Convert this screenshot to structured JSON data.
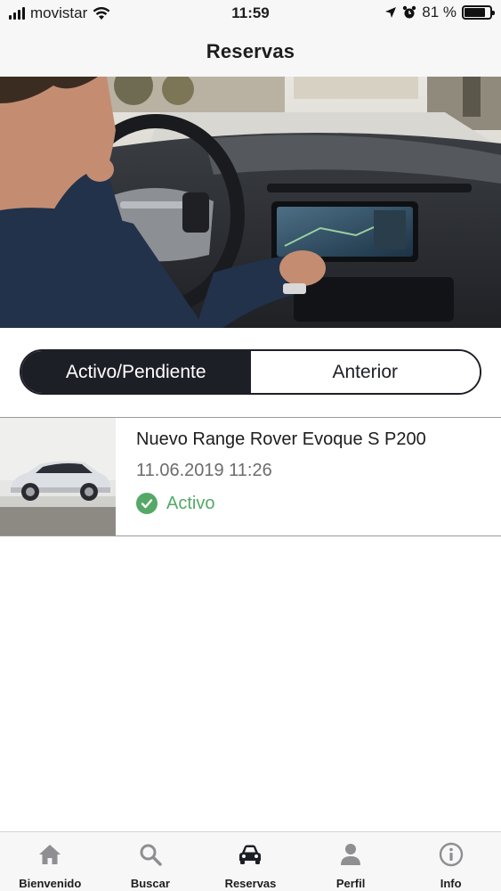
{
  "status_bar": {
    "carrier": "movistar",
    "time": "11:59",
    "battery": "81 %",
    "battery_level": 0.81
  },
  "header": {
    "title": "Reservas"
  },
  "segments": {
    "active_label": "Activo/Pendiente",
    "past_label": "Anterior",
    "selected": "active"
  },
  "reservations": [
    {
      "title": "Nuevo Range Rover Evoque S P200",
      "date": "11.06.2019 11:26",
      "status": "Activo",
      "status_color": "#55a868"
    }
  ],
  "tabs": [
    {
      "label": "Bienvenido",
      "icon": "home-icon"
    },
    {
      "label": "Buscar",
      "icon": "search-icon"
    },
    {
      "label": "Reservas",
      "icon": "car-icon",
      "selected": true
    },
    {
      "label": "Perfil",
      "icon": "person-icon"
    },
    {
      "label": "Info",
      "icon": "info-icon"
    }
  ],
  "colors": {
    "accent_dark": "#1d1f26",
    "inactive_icon": "#8e8e93",
    "bar_background": "#f7f7f7"
  }
}
